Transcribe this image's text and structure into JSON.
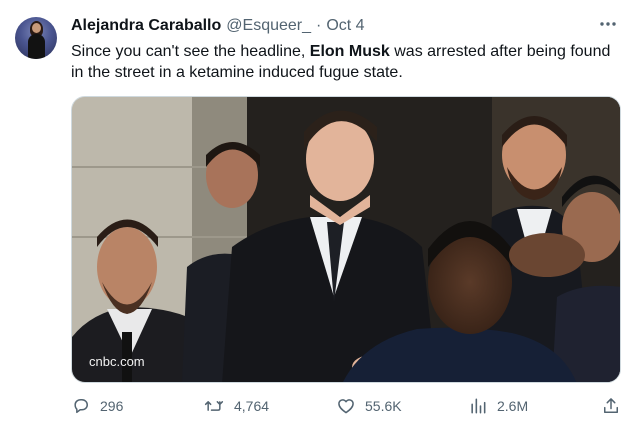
{
  "author": {
    "name": "Alejandra Caraballo",
    "handle": "@Esqueer_",
    "separator": "·",
    "date": "Oct 4"
  },
  "tweet": {
    "text_before": "Since you can't see the headline, ",
    "text_bold": "Elon Musk",
    "text_after": "  was arrested after being found in the street in a ketamine induced fugue state."
  },
  "media": {
    "watermark": "cnbc.com"
  },
  "actions": {
    "replies": "296",
    "retweets": "4,764",
    "likes": "55.6K",
    "views": "2.6M"
  },
  "icons": {
    "more": "more-horizontal-icon",
    "reply": "reply-icon",
    "retweet": "retweet-icon",
    "like": "heart-icon",
    "views": "analytics-icon",
    "share": "share-icon"
  },
  "colors": {
    "text": "#0f1419",
    "secondary": "#536471",
    "border": "#cfd9de"
  }
}
